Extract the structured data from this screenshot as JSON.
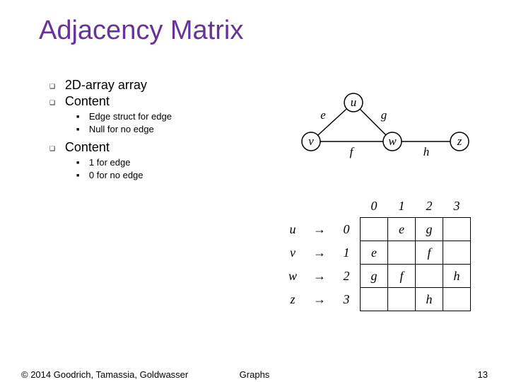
{
  "title": "Adjacency Matrix",
  "bullets": {
    "b1": "2D-array array",
    "b2": "Content",
    "b2_1": "Edge struct for edge",
    "b2_2": "Null for no edge",
    "b3": "Content",
    "b3_1": "1 for edge",
    "b3_2": "0 for no edge"
  },
  "graph": {
    "vertices": [
      "u",
      "v",
      "w",
      "z"
    ],
    "edges": {
      "e": [
        "u",
        "v"
      ],
      "g": [
        "u",
        "w"
      ],
      "f": [
        "v",
        "w"
      ],
      "h": [
        "w",
        "z"
      ]
    },
    "labels": {
      "e": "e",
      "g": "g",
      "f": "f",
      "h": "h",
      "u": "u",
      "v": "v",
      "w": "w",
      "z": "z"
    }
  },
  "matrix": {
    "col_headers": [
      "0",
      "1",
      "2",
      "3"
    ],
    "row_labels": [
      "u",
      "v",
      "w",
      "z"
    ],
    "row_indices": [
      "0",
      "1",
      "2",
      "3"
    ],
    "cells": [
      [
        "",
        "e",
        "g",
        ""
      ],
      [
        "e",
        "",
        "f",
        ""
      ],
      [
        "g",
        "f",
        "",
        "h"
      ],
      [
        "",
        "",
        "h",
        ""
      ]
    ]
  },
  "footer": {
    "copyright": "© 2014 Goodrich, Tamassia, Goldwasser",
    "center": "Graphs",
    "page": "13"
  }
}
